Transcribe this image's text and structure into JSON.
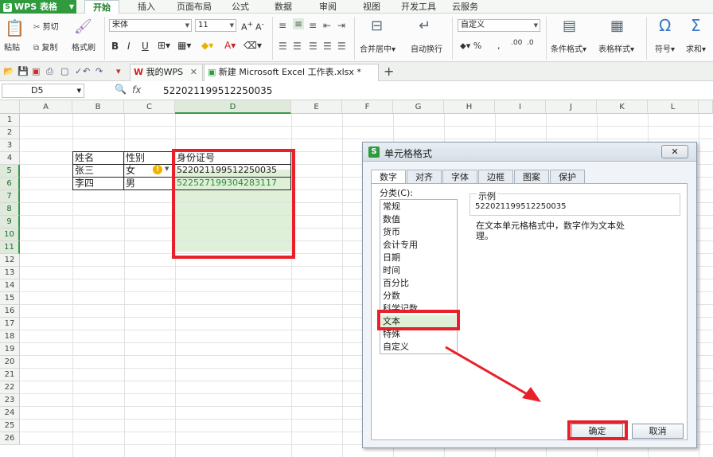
{
  "app": {
    "name": "WPS 表格",
    "logo": "S"
  },
  "menu": [
    "开始",
    "插入",
    "页面布局",
    "公式",
    "数据",
    "审阅",
    "视图",
    "开发工具",
    "云服务"
  ],
  "ribbon": {
    "paste": "粘贴",
    "cut": "剪切",
    "copy": "复制",
    "format_painter": "格式刷",
    "font_name": "宋体",
    "font_size": "11",
    "merge_center": "合并居中",
    "wrap_text": "自动换行",
    "number_format": "自定义",
    "conditional_format": "条件格式",
    "table_style": "表格样式",
    "symbol": "符号",
    "sum": "求和"
  },
  "tabs": {
    "home": "我的WPS",
    "document": "新建 Microsoft Excel 工作表.xlsx *",
    "add": "+"
  },
  "formula_bar": {
    "cell_ref": "D5",
    "fx": "fx",
    "value": "522021199512250035"
  },
  "sheet": {
    "columns": [
      "A",
      "B",
      "C",
      "D",
      "E",
      "F",
      "G",
      "H",
      "I",
      "J",
      "K",
      "L"
    ],
    "rows": [
      "1",
      "2",
      "3",
      "4",
      "5",
      "6",
      "7",
      "8",
      "9",
      "10",
      "11",
      "12",
      "13",
      "14",
      "15",
      "16",
      "17",
      "18",
      "19",
      "20",
      "21",
      "22",
      "23",
      "24",
      "25",
      "26"
    ],
    "cells": {
      "B4": "姓名",
      "C4": "性别",
      "D4": "身份证号",
      "B5": "张三",
      "C5": "女",
      "D5": "522021199512250035",
      "B6": "李四",
      "C6": "男",
      "D6": "522527199304283117"
    }
  },
  "dialog": {
    "title": "单元格格式",
    "tabs": [
      "数字",
      "对齐",
      "字体",
      "边框",
      "图案",
      "保护"
    ],
    "category_label": "分类(C):",
    "categories": [
      "常规",
      "数值",
      "货币",
      "会计专用",
      "日期",
      "时间",
      "百分比",
      "分数",
      "科学记数",
      "文本",
      "特殊",
      "自定义"
    ],
    "selected_category": "文本",
    "sample_label": "示例",
    "sample_value": "522021199512250035",
    "description": "在文本单元格格式中，数字作为文本处理。",
    "ok": "确定",
    "cancel": "取消"
  },
  "colors": {
    "accent": "#2f9a3e",
    "annotation": "#e8202a",
    "selection": "#dff0d8"
  }
}
